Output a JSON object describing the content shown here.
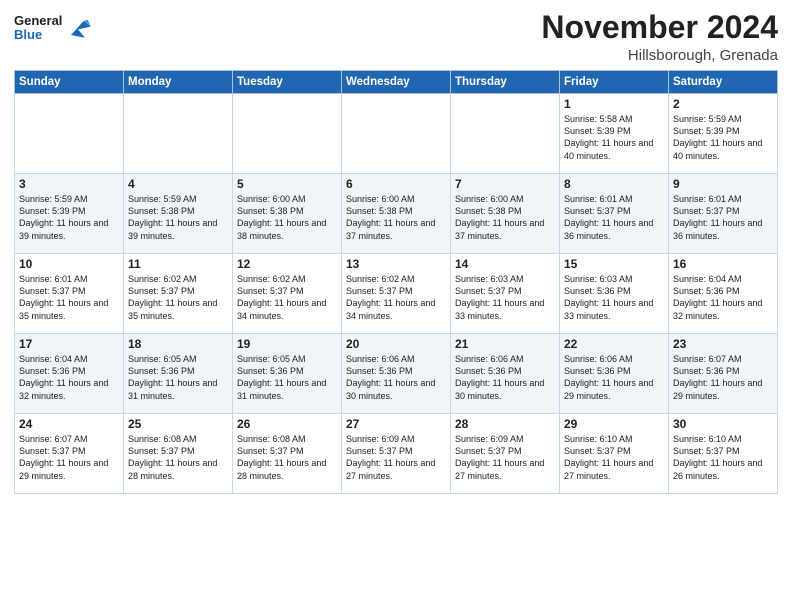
{
  "header": {
    "logo_general": "General",
    "logo_blue": "Blue",
    "month_year": "November 2024",
    "location": "Hillsborough, Grenada"
  },
  "days_of_week": [
    "Sunday",
    "Monday",
    "Tuesday",
    "Wednesday",
    "Thursday",
    "Friday",
    "Saturday"
  ],
  "weeks": [
    [
      {
        "day": "",
        "info": ""
      },
      {
        "day": "",
        "info": ""
      },
      {
        "day": "",
        "info": ""
      },
      {
        "day": "",
        "info": ""
      },
      {
        "day": "",
        "info": ""
      },
      {
        "day": "1",
        "info": "Sunrise: 5:58 AM\nSunset: 5:39 PM\nDaylight: 11 hours and 40 minutes."
      },
      {
        "day": "2",
        "info": "Sunrise: 5:59 AM\nSunset: 5:39 PM\nDaylight: 11 hours and 40 minutes."
      }
    ],
    [
      {
        "day": "3",
        "info": "Sunrise: 5:59 AM\nSunset: 5:39 PM\nDaylight: 11 hours and 39 minutes."
      },
      {
        "day": "4",
        "info": "Sunrise: 5:59 AM\nSunset: 5:38 PM\nDaylight: 11 hours and 39 minutes."
      },
      {
        "day": "5",
        "info": "Sunrise: 6:00 AM\nSunset: 5:38 PM\nDaylight: 11 hours and 38 minutes."
      },
      {
        "day": "6",
        "info": "Sunrise: 6:00 AM\nSunset: 5:38 PM\nDaylight: 11 hours and 37 minutes."
      },
      {
        "day": "7",
        "info": "Sunrise: 6:00 AM\nSunset: 5:38 PM\nDaylight: 11 hours and 37 minutes."
      },
      {
        "day": "8",
        "info": "Sunrise: 6:01 AM\nSunset: 5:37 PM\nDaylight: 11 hours and 36 minutes."
      },
      {
        "day": "9",
        "info": "Sunrise: 6:01 AM\nSunset: 5:37 PM\nDaylight: 11 hours and 36 minutes."
      }
    ],
    [
      {
        "day": "10",
        "info": "Sunrise: 6:01 AM\nSunset: 5:37 PM\nDaylight: 11 hours and 35 minutes."
      },
      {
        "day": "11",
        "info": "Sunrise: 6:02 AM\nSunset: 5:37 PM\nDaylight: 11 hours and 35 minutes."
      },
      {
        "day": "12",
        "info": "Sunrise: 6:02 AM\nSunset: 5:37 PM\nDaylight: 11 hours and 34 minutes."
      },
      {
        "day": "13",
        "info": "Sunrise: 6:02 AM\nSunset: 5:37 PM\nDaylight: 11 hours and 34 minutes."
      },
      {
        "day": "14",
        "info": "Sunrise: 6:03 AM\nSunset: 5:37 PM\nDaylight: 11 hours and 33 minutes."
      },
      {
        "day": "15",
        "info": "Sunrise: 6:03 AM\nSunset: 5:36 PM\nDaylight: 11 hours and 33 minutes."
      },
      {
        "day": "16",
        "info": "Sunrise: 6:04 AM\nSunset: 5:36 PM\nDaylight: 11 hours and 32 minutes."
      }
    ],
    [
      {
        "day": "17",
        "info": "Sunrise: 6:04 AM\nSunset: 5:36 PM\nDaylight: 11 hours and 32 minutes."
      },
      {
        "day": "18",
        "info": "Sunrise: 6:05 AM\nSunset: 5:36 PM\nDaylight: 11 hours and 31 minutes."
      },
      {
        "day": "19",
        "info": "Sunrise: 6:05 AM\nSunset: 5:36 PM\nDaylight: 11 hours and 31 minutes."
      },
      {
        "day": "20",
        "info": "Sunrise: 6:06 AM\nSunset: 5:36 PM\nDaylight: 11 hours and 30 minutes."
      },
      {
        "day": "21",
        "info": "Sunrise: 6:06 AM\nSunset: 5:36 PM\nDaylight: 11 hours and 30 minutes."
      },
      {
        "day": "22",
        "info": "Sunrise: 6:06 AM\nSunset: 5:36 PM\nDaylight: 11 hours and 29 minutes."
      },
      {
        "day": "23",
        "info": "Sunrise: 6:07 AM\nSunset: 5:36 PM\nDaylight: 11 hours and 29 minutes."
      }
    ],
    [
      {
        "day": "24",
        "info": "Sunrise: 6:07 AM\nSunset: 5:37 PM\nDaylight: 11 hours and 29 minutes."
      },
      {
        "day": "25",
        "info": "Sunrise: 6:08 AM\nSunset: 5:37 PM\nDaylight: 11 hours and 28 minutes."
      },
      {
        "day": "26",
        "info": "Sunrise: 6:08 AM\nSunset: 5:37 PM\nDaylight: 11 hours and 28 minutes."
      },
      {
        "day": "27",
        "info": "Sunrise: 6:09 AM\nSunset: 5:37 PM\nDaylight: 11 hours and 27 minutes."
      },
      {
        "day": "28",
        "info": "Sunrise: 6:09 AM\nSunset: 5:37 PM\nDaylight: 11 hours and 27 minutes."
      },
      {
        "day": "29",
        "info": "Sunrise: 6:10 AM\nSunset: 5:37 PM\nDaylight: 11 hours and 27 minutes."
      },
      {
        "day": "30",
        "info": "Sunrise: 6:10 AM\nSunset: 5:37 PM\nDaylight: 11 hours and 26 minutes."
      }
    ]
  ]
}
